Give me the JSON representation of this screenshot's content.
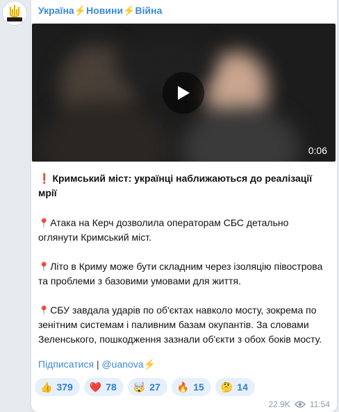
{
  "channel": {
    "name_part1": "Україна",
    "name_part2": "Новини",
    "name_part3": "Війна",
    "bolt": "⚡",
    "avatar_text": "УКРАЇНА НОВИНИ"
  },
  "video": {
    "duration": "0:06",
    "state": "paused"
  },
  "post": {
    "title_emoji": "❗",
    "title": "Кримський міст: українці наближаються до реалізації мрії",
    "pin": "📍",
    "paragraphs": [
      "Атака на Керч дозволила операторам СБС детально оглянути Кримський міст.",
      "Літо в Криму може бути складним через ізоляцію півострова та проблеми з базовими умовами для життя.",
      "СБУ завдала ударів по об'єктах навколо мосту, зокрема по зенітним системам і паливним базам окупантів. За словами Зеленського, пошкодження зазнали об'єкти з обох боків мосту."
    ]
  },
  "links": {
    "subscribe": "Підписатися",
    "separator": "|",
    "handle": "@uanova",
    "bolt": "⚡"
  },
  "reactions": [
    {
      "emoji": "👍",
      "count": "379"
    },
    {
      "emoji": "❤️",
      "count": "78"
    },
    {
      "emoji": "🤯",
      "count": "27"
    },
    {
      "emoji": "🔥",
      "count": "15"
    },
    {
      "emoji": "🤔",
      "count": "14"
    }
  ],
  "meta": {
    "views": "22.9K",
    "time": "11:54"
  },
  "colors": {
    "accent": "#3a8ad6",
    "bolt": "#f5b400",
    "reaction_bg": "#e6f0fb"
  }
}
